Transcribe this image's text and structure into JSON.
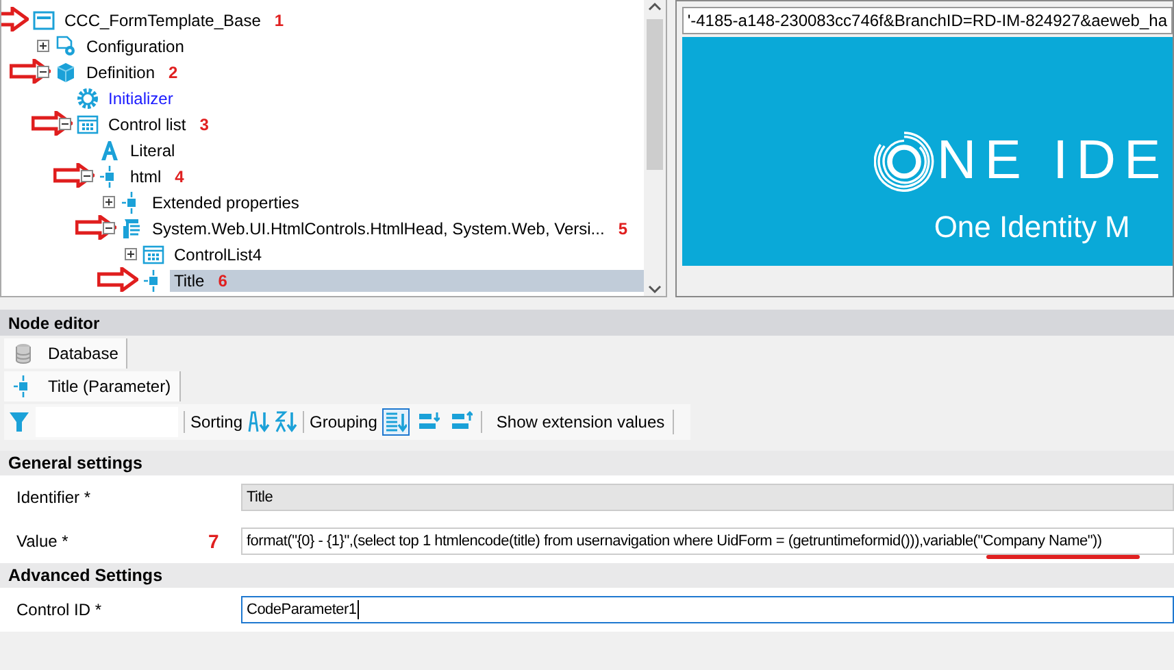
{
  "tree": {
    "items": [
      {
        "label": "CCC_FormTemplate_Base",
        "kind": "form",
        "marker": "1",
        "selected": false,
        "children": [
          {
            "label": "Configuration",
            "kind": "config",
            "expanded": false,
            "selected": false
          },
          {
            "label": "Definition",
            "kind": "cube",
            "expanded": true,
            "marker": "2",
            "selected": false,
            "children": [
              {
                "label": "Initializer",
                "kind": "gear",
                "link": true,
                "selected": false
              },
              {
                "label": "Control list",
                "kind": "grid",
                "expanded": true,
                "marker": "3",
                "selected": false,
                "children": [
                  {
                    "label": "Literal",
                    "kind": "letter",
                    "selected": false
                  },
                  {
                    "label": "html",
                    "kind": "param",
                    "expanded": true,
                    "marker": "4",
                    "selected": false,
                    "children": [
                      {
                        "label": "Extended properties",
                        "kind": "param",
                        "expanded": false,
                        "selected": false
                      },
                      {
                        "label": "System.Web.UI.HtmlControls.HtmlHead, System.Web, Versi...",
                        "kind": "script",
                        "expanded": true,
                        "marker": "5",
                        "selected": false,
                        "children": [
                          {
                            "label": "ControlList4",
                            "kind": "grid",
                            "expanded": false,
                            "selected": false
                          },
                          {
                            "label": "Title",
                            "kind": "param",
                            "marker": "6",
                            "selected": true
                          }
                        ]
                      }
                    ]
                  }
                ]
              }
            ]
          }
        ]
      }
    ]
  },
  "preview": {
    "url": "'-4185-a148-230083cc746f&BranchID=RD-IM-824927&aeweb_ha",
    "logo": "NE IDE",
    "subtitle": "One Identity M"
  },
  "node_editor": {
    "title": "Node editor",
    "tabs": [
      {
        "label": "Database",
        "kind": "database"
      },
      {
        "label": "Title (Parameter)",
        "kind": "param"
      }
    ],
    "toolbar": {
      "sorting_label": "Sorting",
      "grouping_label": "Grouping",
      "grouping_options": [
        {
          "selected": true
        },
        {
          "selected": false
        },
        {
          "selected": false
        }
      ],
      "extension_button": "Show extension values"
    },
    "sections": [
      {
        "title": "General settings",
        "fields": [
          {
            "label": "Identifier *",
            "value": "Title",
            "readonly": true
          },
          {
            "label": "Value *",
            "marker": "7",
            "value": "format(\"{0} - {1}\",(select top 1 htmlencode(title) from usernavigation where UidForm = (getruntimeformid())),variable(\"Company Name\"))",
            "readonly": false,
            "underline_end": true
          }
        ]
      },
      {
        "title": "Advanced Settings",
        "fields": [
          {
            "label": "Control ID *",
            "value": "CodeParameter1",
            "readonly": false,
            "focused": true
          }
        ]
      }
    ]
  }
}
